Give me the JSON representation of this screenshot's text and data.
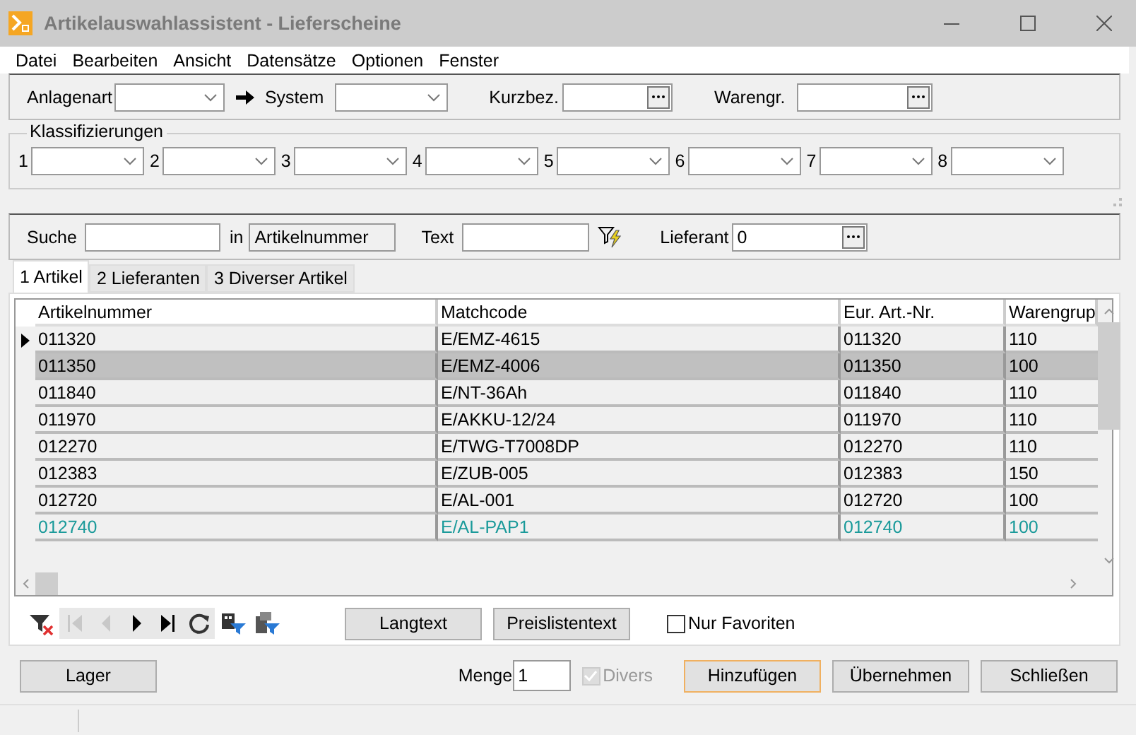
{
  "window": {
    "title": "Artikelauswahlassistent - Lieferscheine"
  },
  "menu": [
    "Datei",
    "Bearbeiten",
    "Ansicht",
    "Datensätze",
    "Optionen",
    "Fenster"
  ],
  "filter_bar": {
    "anlagenart": {
      "label": "Anlagenart"
    },
    "system": {
      "label": "System"
    },
    "kurzbez": {
      "label": "Kurzbez."
    },
    "warengr": {
      "label": "Warengr."
    }
  },
  "klassifizierungen": {
    "title": "Klassifizierungen",
    "slots": [
      "1",
      "2",
      "3",
      "4",
      "5",
      "6",
      "7",
      "8"
    ]
  },
  "search": {
    "label": "Suche",
    "in_label": "in",
    "in_field": "Artikelnummer",
    "text_label": "Text",
    "lieferant_label": "Lieferant",
    "lieferant_value": "0"
  },
  "tabs": [
    {
      "label": "1 Artikel",
      "selected": true
    },
    {
      "label": "2 Lieferanten",
      "selected": false
    },
    {
      "label": "3 Diverser Artikel",
      "selected": false
    }
  ],
  "table": {
    "columns": [
      "Artikelnummer",
      "Matchcode",
      "Eur. Art.-Nr.",
      "Warengrup"
    ],
    "rows": [
      {
        "cells": [
          "011320",
          "E/EMZ-4615",
          "011320",
          "110"
        ],
        "selected": false,
        "current": true,
        "color": "#000000"
      },
      {
        "cells": [
          "011350",
          "E/EMZ-4006",
          "011350",
          "100"
        ],
        "selected": true,
        "current": false,
        "color": "#000000"
      },
      {
        "cells": [
          "011840",
          "E/NT-36Ah",
          "011840",
          "110"
        ],
        "selected": false,
        "current": false,
        "color": "#000000"
      },
      {
        "cells": [
          "011970",
          "E/AKKU-12/24",
          "011970",
          "110"
        ],
        "selected": false,
        "current": false,
        "color": "#000000"
      },
      {
        "cells": [
          "012270",
          "E/TWG-T7008DP",
          "012270",
          "110"
        ],
        "selected": false,
        "current": false,
        "color": "#000000"
      },
      {
        "cells": [
          "012383",
          "E/ZUB-005",
          "012383",
          "150"
        ],
        "selected": false,
        "current": false,
        "color": "#000000"
      },
      {
        "cells": [
          "012720",
          "E/AL-001",
          "012720",
          "100"
        ],
        "selected": false,
        "current": false,
        "color": "#000000"
      },
      {
        "cells": [
          "012740",
          "E/AL-PAP1",
          "012740",
          "100"
        ],
        "selected": false,
        "current": false,
        "color": "#1a9a9a"
      }
    ]
  },
  "nav_buttons": [
    {
      "kind": "first",
      "disabled": true
    },
    {
      "kind": "prev",
      "disabled": true
    },
    {
      "kind": "next",
      "disabled": false
    },
    {
      "kind": "last",
      "disabled": false
    }
  ],
  "toolbar_buttons": [
    {
      "label": "Langtext"
    },
    {
      "label": "Preislistentext"
    }
  ],
  "nur_favoriten": {
    "label": "Nur Favoriten",
    "checked": false
  },
  "footer": {
    "lager": "Lager",
    "menge_label": "Menge",
    "menge_value": "1",
    "divers": {
      "label": "Divers",
      "checked": true,
      "disabled": true
    },
    "buttons": [
      {
        "label": "Hinzufügen",
        "focused": true
      },
      {
        "label": "Übernehmen",
        "focused": false
      },
      {
        "label": "Schließen",
        "focused": false
      }
    ]
  }
}
